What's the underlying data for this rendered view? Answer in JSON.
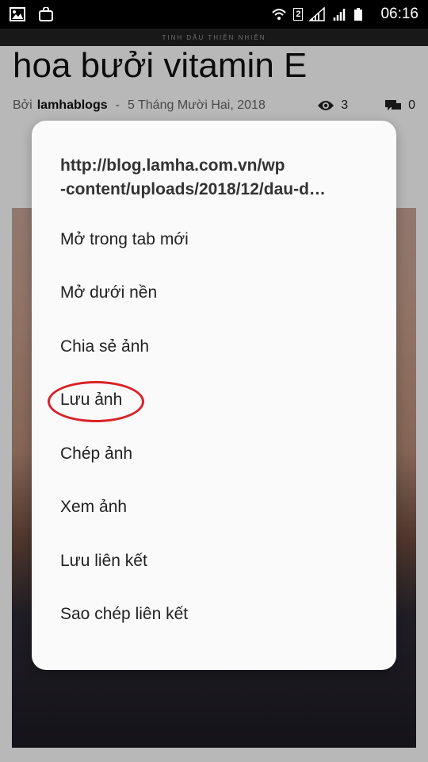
{
  "status_bar": {
    "sim_badge": "2",
    "time": "06:16",
    "left_icons": [
      "image-icon",
      "shopping-bag-icon"
    ],
    "right_icons": [
      "wifi-icon",
      "signal-icon",
      "signal-icon",
      "battery-icon"
    ]
  },
  "site": {
    "strip_text": "TINH DẦU THIÊN NHIÊN"
  },
  "article": {
    "title": "hoa bưởi vitamin E",
    "by_label": "Bởi",
    "author": "lamhablogs",
    "separator": "-",
    "date": "5 Tháng Mười Hai, 2018",
    "views": "3",
    "comments": "0"
  },
  "context_menu": {
    "url_line1": "http://blog.lamha.com.vn/wp",
    "url_line2": "-content/uploads/2018/12/dau-d…",
    "items": [
      {
        "label": "Mở trong tab mới"
      },
      {
        "label": "Mở dưới nền"
      },
      {
        "label": "Chia sẻ ảnh"
      },
      {
        "label": "Lưu ảnh",
        "highlighted": true
      },
      {
        "label": "Chép ảnh"
      },
      {
        "label": "Xem ảnh"
      },
      {
        "label": "Lưu liên kết"
      },
      {
        "label": "Sao chép liên kết"
      }
    ]
  },
  "colors": {
    "highlight_ring": "#d9222a",
    "dialog_bg": "#fafafa"
  }
}
